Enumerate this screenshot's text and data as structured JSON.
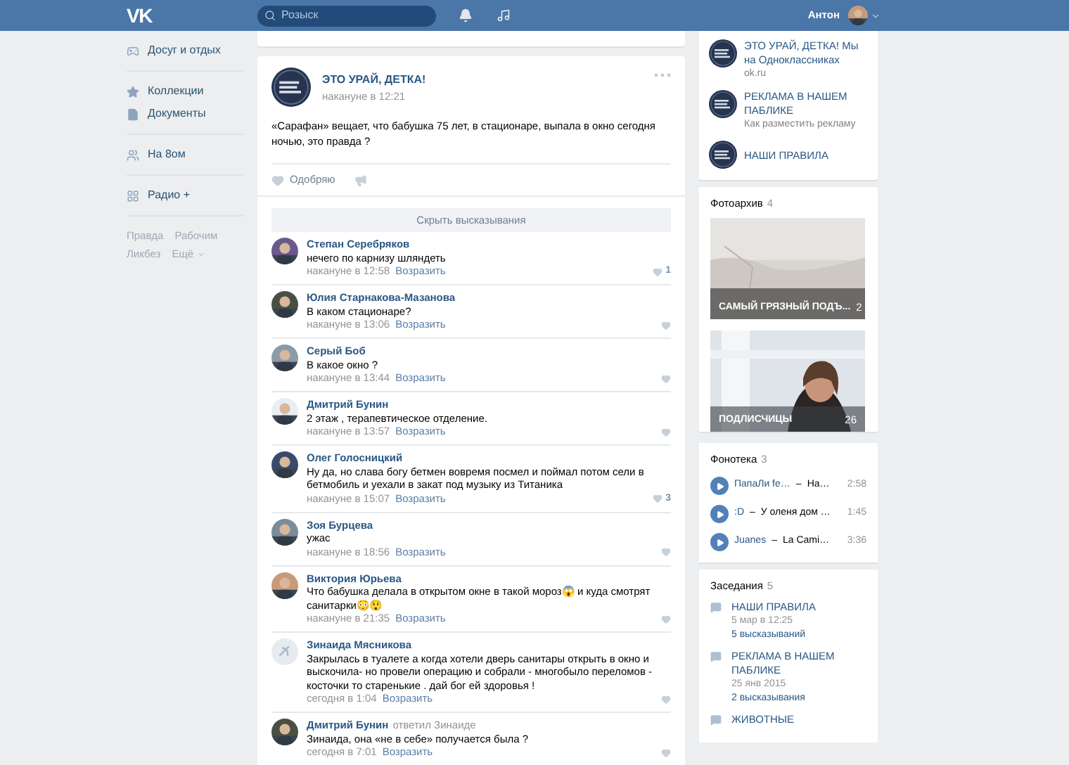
{
  "header": {
    "logo": "VK",
    "search_placeholder": "Розыск",
    "user_name": "Антон"
  },
  "sidebar": {
    "groups": [
      [
        {
          "kind": "games",
          "label": "Досуг и отдых"
        }
      ],
      [
        {
          "kind": "star",
          "label": "Коллекции"
        },
        {
          "kind": "doc",
          "label": "Документы"
        }
      ],
      [
        {
          "kind": "people",
          "label": "На 8ом"
        }
      ],
      [
        {
          "kind": "grid",
          "label": "Радио +"
        }
      ]
    ],
    "footer_links": [
      "Правда",
      "Рабочим",
      "Ликбез",
      "Ещё"
    ]
  },
  "post": {
    "author": "ЭТО УРАЙ, ДЕТКА!",
    "time": "накануне в 12:21",
    "text": "«Сарафан» вещает, что бабушка 75 лет, в стационаре, выпала в окно сегодня ночью, это правда ?",
    "like_label": "Одобряю",
    "hide_comments": "Скрыть высказывания"
  },
  "comments": [
    {
      "name": "Степан Серебряков",
      "text": "нечего по карнизу шляндеть",
      "time": "накануне в 12:58",
      "reply": "Возразить",
      "likes": "1"
    },
    {
      "name": "Юлия Старнакова-Мазанова",
      "text": "В каком стационаре?",
      "time": "накануне в 13:06",
      "reply": "Возразить"
    },
    {
      "name": "Серый Боб",
      "text": "В какое окно ?",
      "time": "накануне в 13:44",
      "reply": "Возразить"
    },
    {
      "name": "Дмитрий Бунин",
      "text": "2 этаж , терапевтическое отделение.",
      "time": "накануне в 13:57",
      "reply": "Возразить"
    },
    {
      "name": "Олег Голосницкий",
      "text": "Ну да, но слава богу бетмен вовремя посмел и поймал потом сели в бетмобиль и уехали в закат под музыку из Титаника",
      "time": "накануне в 15:07",
      "reply": "Возразить",
      "likes": "3"
    },
    {
      "name": "Зоя Бурцева",
      "text": "ужас",
      "time": "накануне в 18:56",
      "reply": "Возразить"
    },
    {
      "name": "Виктория Юрьева",
      "text": "Что бабушка делала в открытом окне в такой мороз😱 и куда смотрят санитарки😳😲",
      "time": "накануне в 21:35",
      "reply": "Возразить"
    },
    {
      "name": "Зинаида Мясникова",
      "kind": "emblem",
      "text": "Закрылась в туалете а когда хотели дверь санитары открыть в окно и выскочила- но провели операцию и собрали - многобыло переломов - косточки то старенькие . дай бог ей здоровья !",
      "time": "сегодня в 1:04",
      "reply": "Возразить"
    },
    {
      "name": "Дмитрий Бунин",
      "reply_note": "ответил Зинаиде",
      "text": "Зинаида, она «не в себе» получается была ?",
      "time": "сегодня в 7:01",
      "reply": "Возразить"
    }
  ],
  "right": {
    "links": [
      {
        "title": "ЭТО УРАЙ, ДЕТКА! Мы на Одноклассниках",
        "subtitle": "ok.ru"
      },
      {
        "title": "РЕКЛАМА В НАШЕМ ПАБЛИКЕ",
        "subtitle": "Как разместить рекламу"
      },
      {
        "title": "НАШИ ПРАВИЛА"
      }
    ],
    "photos": {
      "title": "Фотоархив",
      "count": "4",
      "albums": [
        {
          "name": "САМЫЙ ГРЯЗНЫЙ ПОДЪ...",
          "count": "2",
          "kind": "wall"
        },
        {
          "name": "ПОДЛИСЧИЦЫ",
          "count": "26",
          "kind": "person"
        }
      ]
    },
    "audio": {
      "title": "Фонотека",
      "count": "3",
      "tracks": [
        {
          "artist": "ПапаЛи fe…",
          "dash": "–",
          "title": "На…",
          "duration": "2:58"
        },
        {
          "artist": ":D",
          "dash": "–",
          "title": "У оленя дом …",
          "duration": "1:45"
        },
        {
          "artist": "Juanes",
          "dash": "–",
          "title": "La Cami…",
          "duration": "3:36"
        }
      ]
    },
    "topics": {
      "title": "Заседания",
      "count": "5",
      "items": [
        {
          "title": "НАШИ ПРАВИЛА",
          "date": "5 мар в 12:25",
          "comments": "5 высказываний"
        },
        {
          "title": "РЕКЛАМА В НАШЕМ ПАБЛИКЕ",
          "date": "25 янв 2015",
          "comments": "2 высказывания"
        },
        {
          "title": "ЖИВОТНЫЕ"
        }
      ]
    }
  }
}
